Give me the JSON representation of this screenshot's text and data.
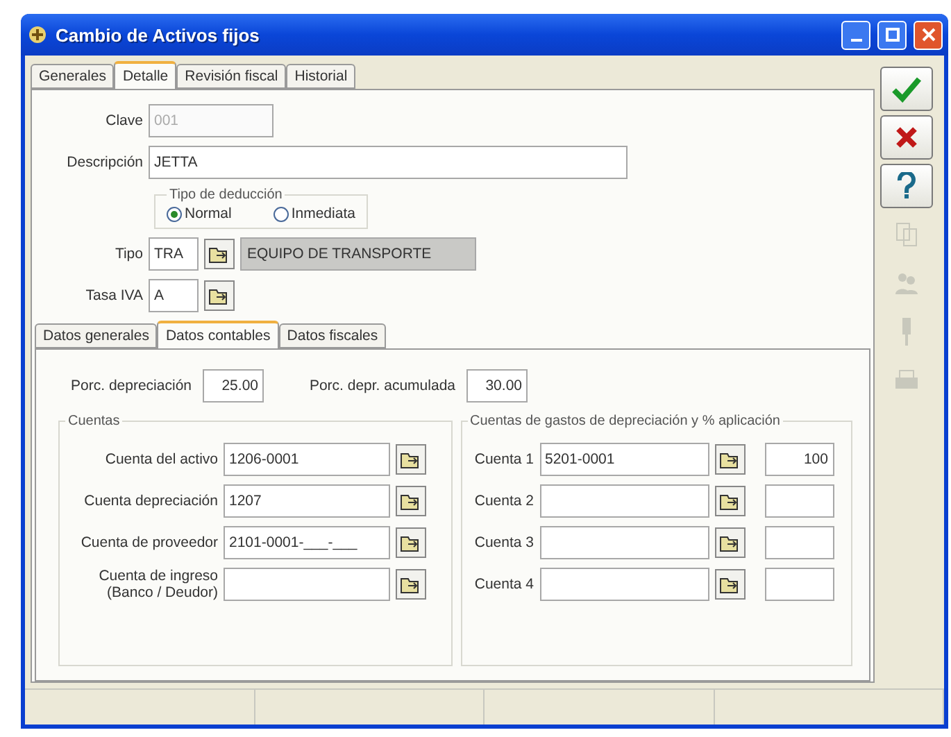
{
  "window": {
    "title": "Cambio de Activos fijos"
  },
  "tabs": [
    {
      "label": "Generales",
      "selected": false
    },
    {
      "label": "Detalle",
      "selected": true
    },
    {
      "label": "Revisión fiscal",
      "selected": false
    },
    {
      "label": "Historial",
      "selected": false
    }
  ],
  "clave": {
    "label": "Clave",
    "value": "001",
    "disabled": true
  },
  "descripcion": {
    "label": "Descripción",
    "value": "JETTA"
  },
  "deduccion": {
    "title": "Tipo de deducción",
    "options": [
      {
        "label": "Normal",
        "selected": true
      },
      {
        "label": "Inmediata",
        "selected": false
      }
    ]
  },
  "tipo": {
    "label": "Tipo",
    "value": "TRA",
    "description": "EQUIPO DE TRANSPORTE"
  },
  "tasa_iva": {
    "label": "Tasa IVA",
    "value": "A"
  },
  "subtabs": [
    {
      "label": "Datos generales",
      "selected": false
    },
    {
      "label": "Datos contables",
      "selected": true
    },
    {
      "label": "Datos fiscales",
      "selected": false
    }
  ],
  "porc_depreciacion": {
    "label": "Porc. depreciación",
    "value": "25.00"
  },
  "porc_acumulada": {
    "label": "Porc. depr. acumulada",
    "value": "30.00"
  },
  "cuentas": {
    "title": "Cuentas",
    "rows": [
      {
        "label": "Cuenta del activo",
        "value": "1206-0001"
      },
      {
        "label": "Cuenta depreciación",
        "value": "1207"
      },
      {
        "label": "Cuenta de proveedor",
        "value": "2101-0001-___-___"
      },
      {
        "label": "Cuenta de ingreso\n(Banco / Deudor)",
        "value": ""
      }
    ]
  },
  "gastos": {
    "title": "Cuentas de gastos de depreciación  y % aplicación",
    "rows": [
      {
        "label": "Cuenta 1",
        "value": "5201-0001",
        "percent": "100"
      },
      {
        "label": "Cuenta 2",
        "value": "",
        "percent": ""
      },
      {
        "label": "Cuenta 3",
        "value": "",
        "percent": ""
      },
      {
        "label": "Cuenta 4",
        "value": "",
        "percent": ""
      }
    ]
  },
  "toolbar": [
    {
      "kind": "accept",
      "disabled": false
    },
    {
      "kind": "cancel",
      "disabled": false
    },
    {
      "kind": "help",
      "disabled": false
    },
    {
      "kind": "copy",
      "disabled": true
    },
    {
      "kind": "people",
      "disabled": true
    },
    {
      "kind": "pin",
      "disabled": true
    },
    {
      "kind": "print",
      "disabled": true
    }
  ]
}
